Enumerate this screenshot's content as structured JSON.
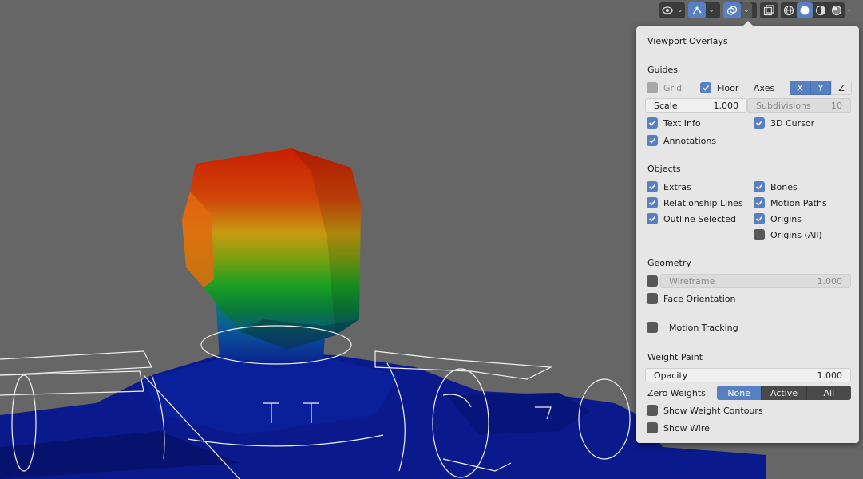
{
  "popover": {
    "title": "Viewport Overlays",
    "guides": {
      "heading": "Guides",
      "grid": "Grid",
      "floor": "Floor",
      "axes_label": "Axes",
      "axes": [
        "X",
        "Y",
        "Z"
      ],
      "scale_label": "Scale",
      "scale_value": "1.000",
      "subdiv_label": "Subdivisions",
      "subdiv_value": "10",
      "text_info": "Text Info",
      "cursor": "3D Cursor",
      "annotations": "Annotations"
    },
    "objects": {
      "heading": "Objects",
      "extras": "Extras",
      "bones": "Bones",
      "relationship_lines": "Relationship Lines",
      "motion_paths": "Motion Paths",
      "outline_selected": "Outline Selected",
      "origins": "Origins",
      "origins_all": "Origins (All)"
    },
    "geometry": {
      "heading": "Geometry",
      "wireframe_label": "Wireframe",
      "wireframe_value": "1.000",
      "face_orientation": "Face Orientation",
      "motion_tracking": "Motion Tracking"
    },
    "weight_paint": {
      "heading": "Weight Paint",
      "opacity_label": "Opacity",
      "opacity_value": "1.000",
      "zero_weights_label": "Zero Weights",
      "zero_weights_options": [
        "None",
        "Active",
        "All"
      ],
      "show_weight_contours": "Show Weight Contours",
      "show_wire": "Show Wire"
    }
  },
  "colors": {
    "accent": "#5680c2",
    "background": "#666666",
    "popover_bg": "#e6e6e6",
    "mesh_blue": "#0a1a8c"
  },
  "header_icons": [
    "eye-icon",
    "gizmo-icon",
    "overlay-icon",
    "xray-icon",
    "wireframe-shading-icon",
    "solid-shading-icon",
    "material-shading-icon",
    "rendered-shading-icon"
  ]
}
